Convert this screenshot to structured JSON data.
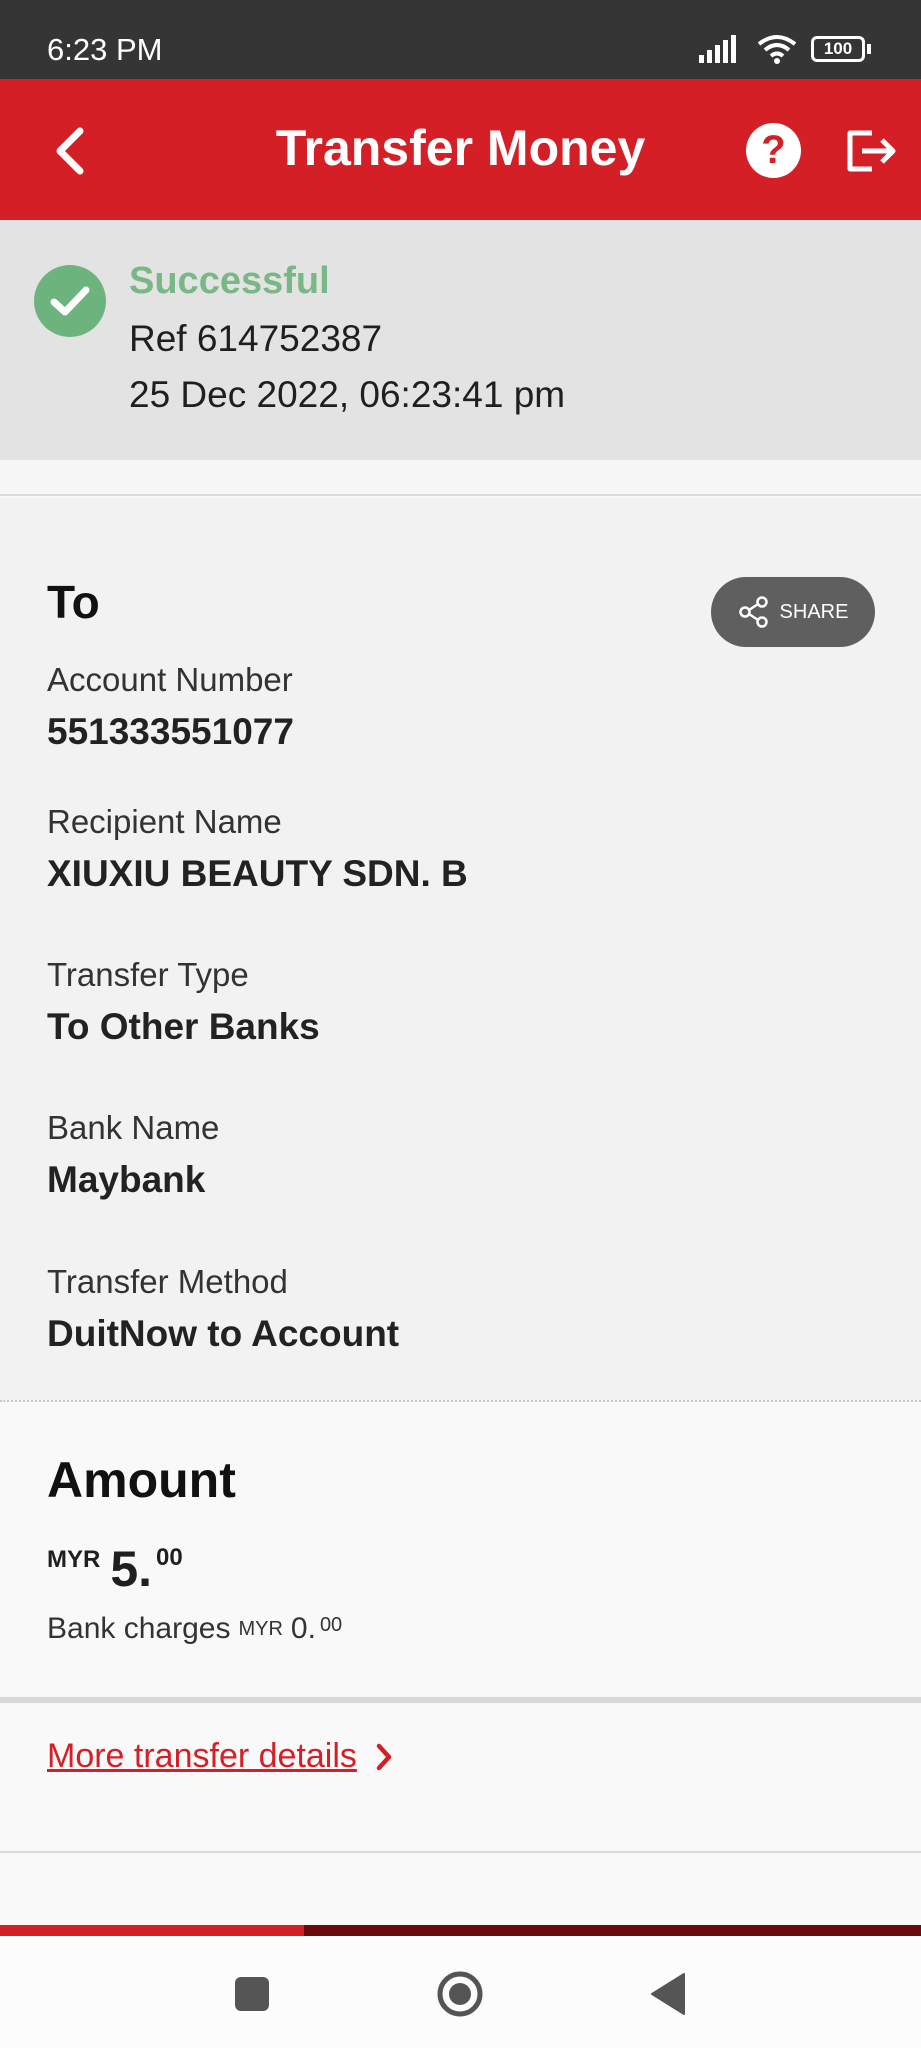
{
  "status_bar": {
    "time": "6:23 PM",
    "battery": "100"
  },
  "header": {
    "title": "Transfer Money"
  },
  "status": {
    "title": "Successful",
    "reference": "Ref 614752387",
    "datetime": "25 Dec 2022, 06:23:41 pm"
  },
  "recipient": {
    "heading": "To",
    "share_label": "SHARE",
    "fields": [
      {
        "label": "Account Number",
        "value": "551333551077"
      },
      {
        "label": "Recipient Name",
        "value": "XIUXIU BEAUTY SDN. B"
      },
      {
        "label": "Transfer Type",
        "value": "To Other Banks"
      },
      {
        "label": "Bank Name",
        "value": "Maybank"
      },
      {
        "label": "Transfer Method",
        "value": "DuitNow to Account"
      }
    ]
  },
  "amount": {
    "heading": "Amount",
    "currency": "MYR",
    "integer": "5.",
    "decimals": "00",
    "charges_label": "Bank charges",
    "charges_currency": "MYR",
    "charges_integer": "0.",
    "charges_decimals": "00"
  },
  "more_details_label": "More transfer details",
  "progress": {
    "fraction": 0.33
  },
  "colors": {
    "brand_red": "#d41f26",
    "success_green": "#6cb37d",
    "banner_gray": "#e3e3e3"
  }
}
